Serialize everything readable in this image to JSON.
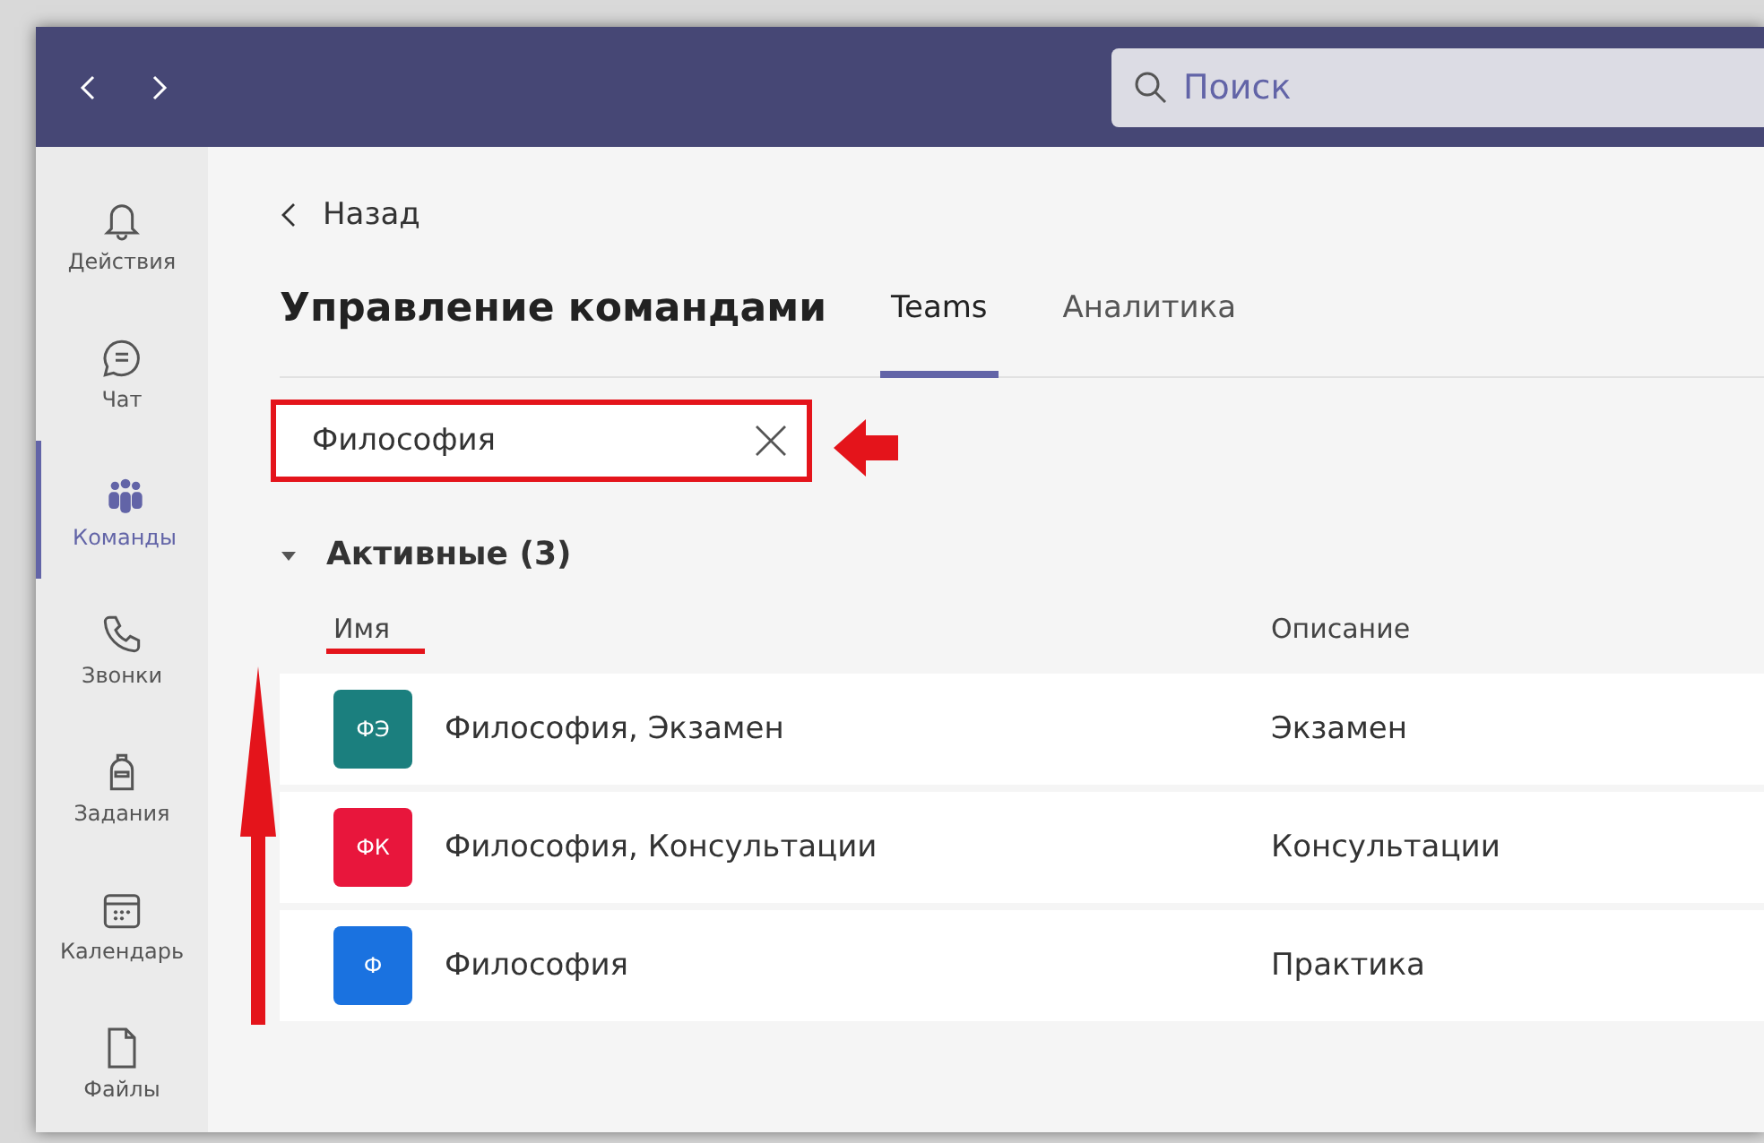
{
  "titlebar": {
    "search": {
      "placeholder": "Поиск"
    }
  },
  "sidebar": {
    "items": [
      {
        "label": "Действия",
        "selected": false
      },
      {
        "label": "Чат",
        "selected": false
      },
      {
        "label": "Команды",
        "selected": true
      },
      {
        "label": "Звонки",
        "selected": false
      },
      {
        "label": "Задания",
        "selected": false
      },
      {
        "label": "Календарь",
        "selected": false
      },
      {
        "label": "Файлы",
        "selected": false
      }
    ]
  },
  "back": {
    "label": "Назад"
  },
  "page_title": "Управление командами",
  "tabs": [
    {
      "label": "Teams",
      "selected": true
    },
    {
      "label": "Аналитика",
      "selected": false
    }
  ],
  "filter": {
    "value": "Философия"
  },
  "group": {
    "label": "Активные (3)",
    "expanded": true
  },
  "table": {
    "columns": [
      "Имя",
      "Описание"
    ],
    "rows": [
      {
        "initials": "ФЭ",
        "color": "#1b7f7e",
        "name": "Философия, Экзамен",
        "description": "Экзамен"
      },
      {
        "initials": "ФК",
        "color": "#e8163c",
        "name": "Философия, Консультации",
        "description": "Консультации"
      },
      {
        "initials": "Ф",
        "color": "#1a72e0",
        "name": "Философия",
        "description": "Практика"
      }
    ]
  }
}
